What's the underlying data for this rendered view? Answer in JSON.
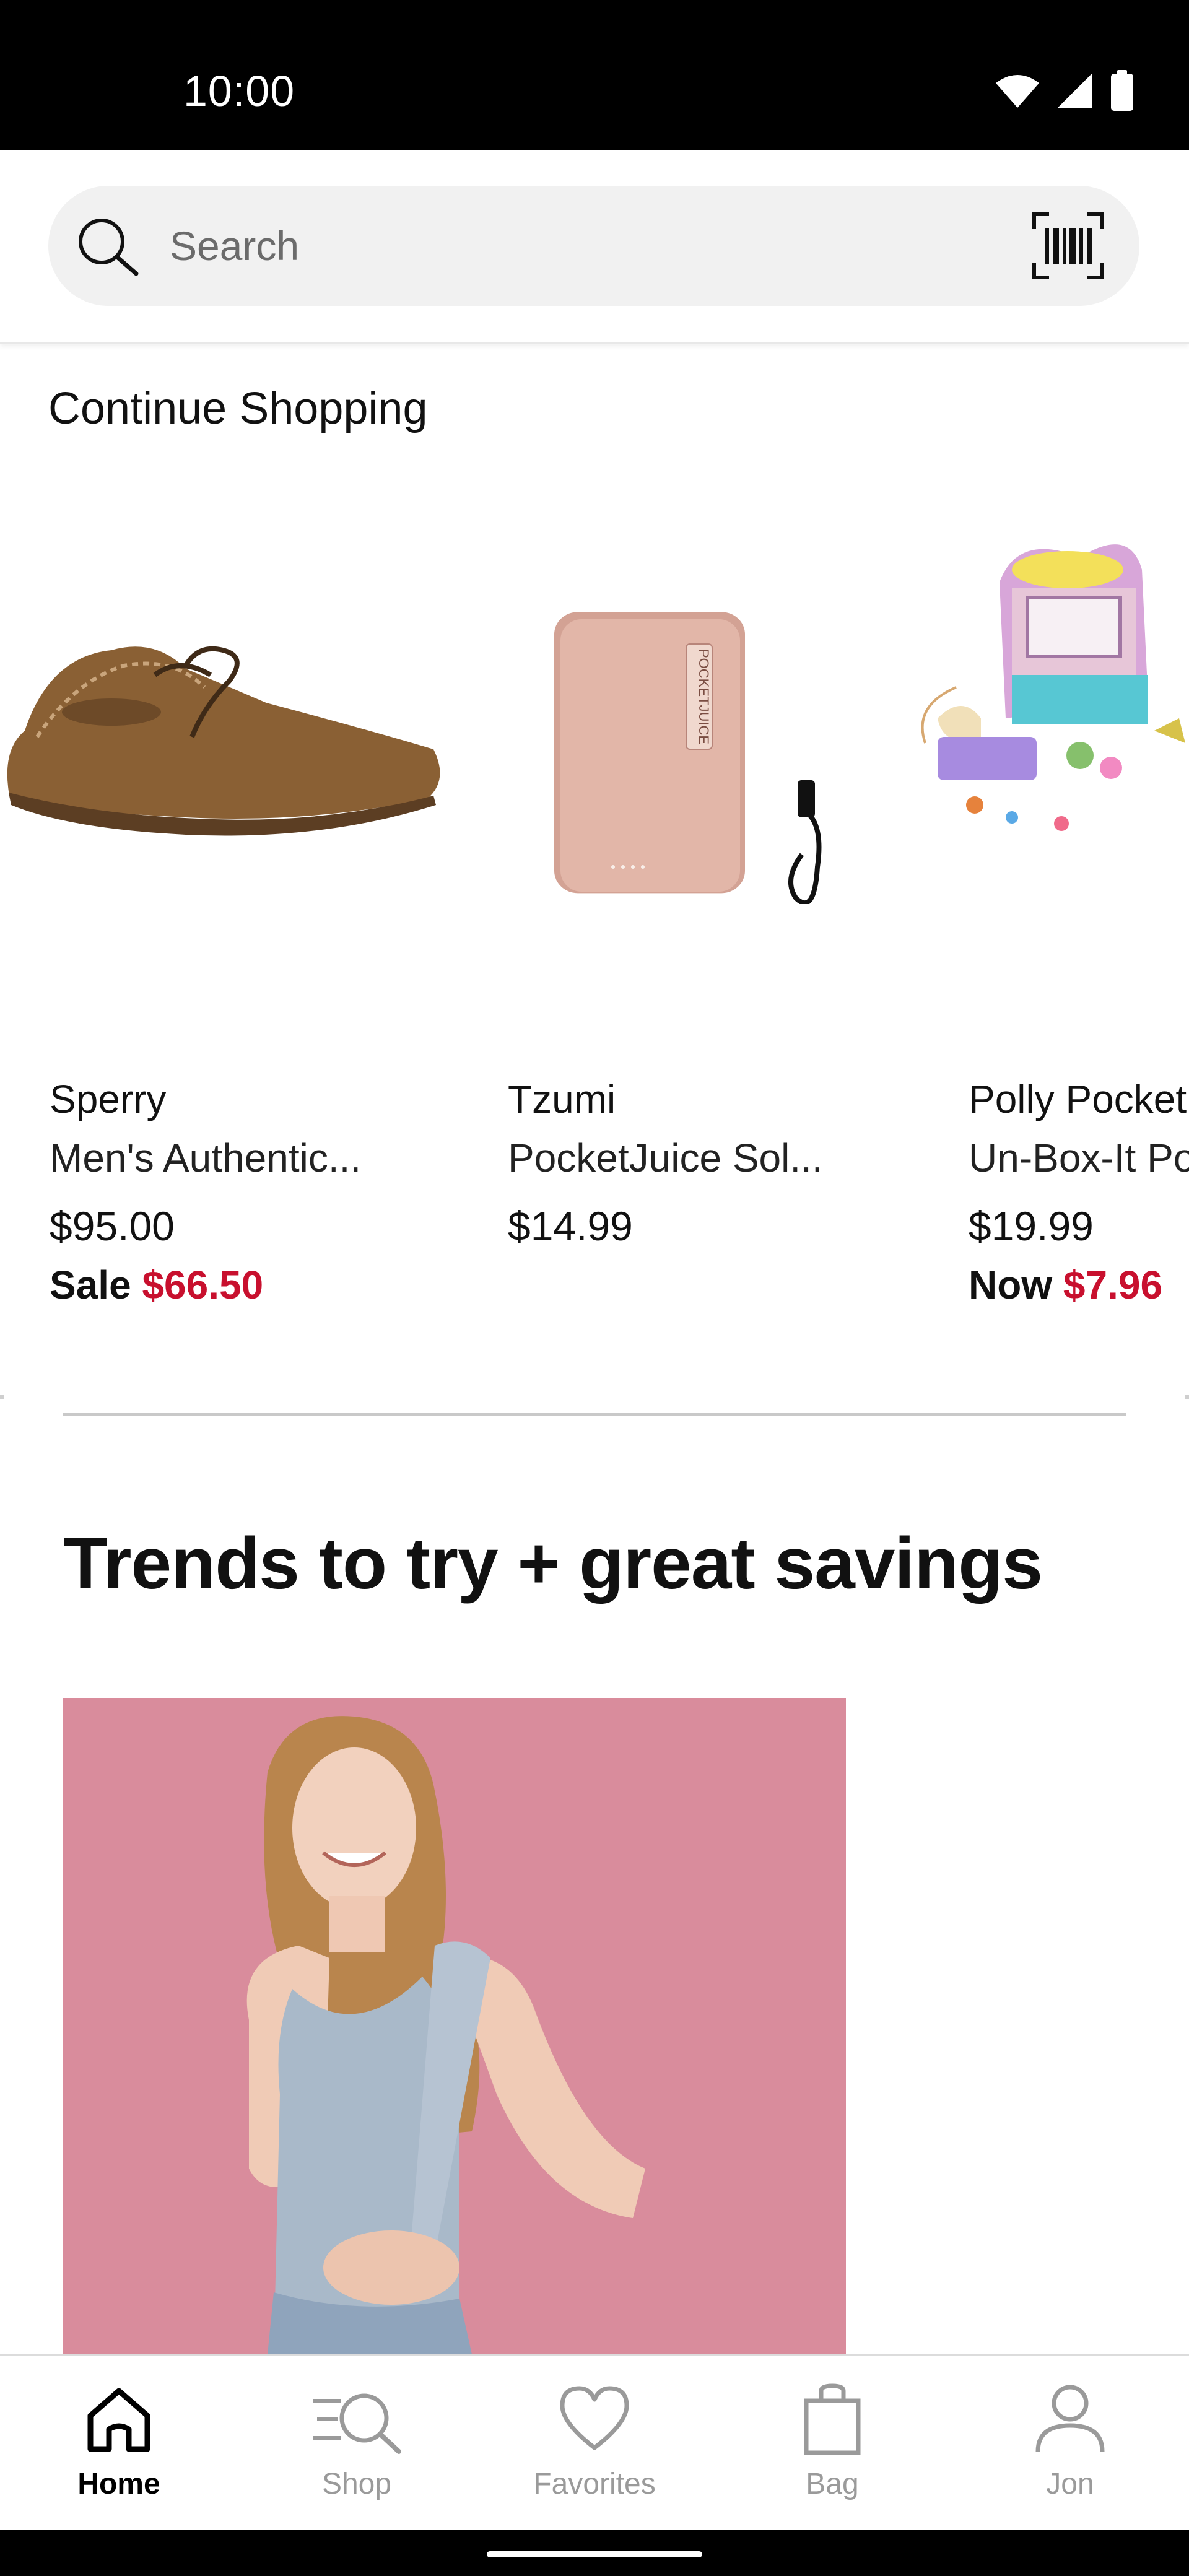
{
  "status_bar": {
    "time": "10:00",
    "icons": [
      "wifi-icon",
      "cellular-signal-icon",
      "battery-icon"
    ]
  },
  "search": {
    "placeholder": "Search",
    "icons": [
      "search-icon",
      "barcode-scanner-icon"
    ]
  },
  "continue_shopping": {
    "title": "Continue Shopping",
    "products": [
      {
        "brand": "Sperry",
        "name": "Men's Authentic...",
        "price": "$95.00",
        "sale_label": "Sale",
        "sale_price": "$66.50",
        "image": "brown-boat-shoe"
      },
      {
        "brand": "Tzumi",
        "name": "PocketJuice Sol...",
        "price": "$14.99",
        "image": "rose-gold-power-bank",
        "image_text": "POCKETJUICE"
      },
      {
        "brand": "Polly Pocket",
        "name": "Un-Box-It Po",
        "price": "$19.99",
        "sale_label": "Now",
        "sale_price": "$7.96",
        "image": "polly-pocket-playset"
      }
    ]
  },
  "trends": {
    "title": "Trends to try + great savings",
    "image": "smiling-woman-pink-background"
  },
  "bottom_nav": {
    "items": [
      {
        "label": "Home",
        "icon": "home-icon",
        "active": true
      },
      {
        "label": "Shop",
        "icon": "shop-search-icon",
        "active": false
      },
      {
        "label": "Favorites",
        "icon": "heart-icon",
        "active": false
      },
      {
        "label": "Bag",
        "icon": "bag-icon",
        "active": false
      },
      {
        "label": "Jon",
        "icon": "account-icon",
        "active": false
      }
    ]
  },
  "colors": {
    "sale_red": "#c8102e",
    "search_bg": "#f1f1f1",
    "promo_bg": "#d88a9a",
    "inactive_nav": "#9a9a9a"
  }
}
